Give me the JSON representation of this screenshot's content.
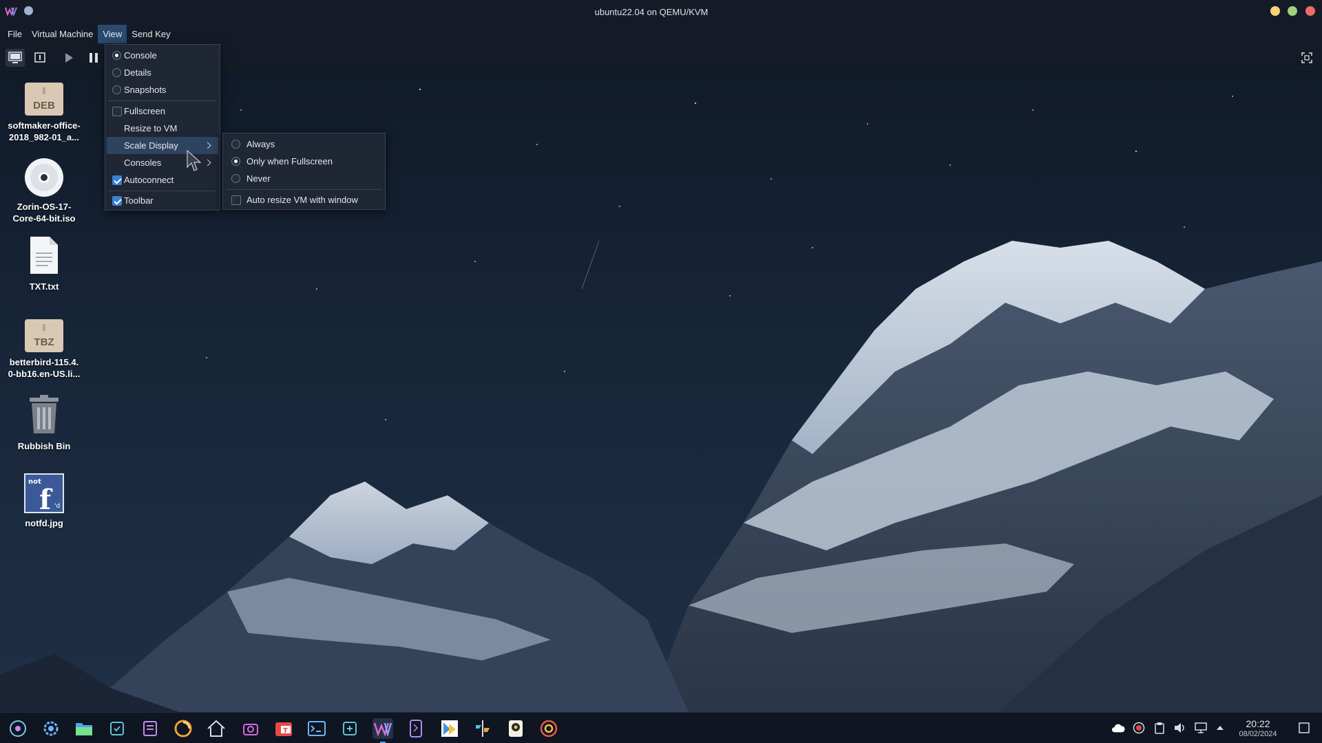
{
  "window": {
    "title": "ubuntu22.04 on QEMU/KVM"
  },
  "menubar": {
    "items": [
      "File",
      "Virtual Machine",
      "View",
      "Send Key"
    ],
    "active": "View"
  },
  "view_menu": {
    "items": [
      {
        "label": "Console",
        "type": "radio",
        "checked": true
      },
      {
        "label": "Details",
        "type": "radio",
        "checked": false
      },
      {
        "label": "Snapshots",
        "type": "radio",
        "checked": false
      },
      {
        "label": "Fullscreen",
        "type": "check",
        "checked": false
      },
      {
        "label": "Resize to VM",
        "type": "plain"
      },
      {
        "label": "Scale Display",
        "type": "submenu"
      },
      {
        "label": "Consoles",
        "type": "submenu"
      },
      {
        "label": "Autoconnect",
        "type": "check",
        "checked": true
      },
      {
        "label": "Toolbar",
        "type": "check",
        "checked": true
      }
    ]
  },
  "scale_menu": {
    "items": [
      {
        "label": "Always",
        "type": "radio",
        "checked": false
      },
      {
        "label": "Only when Fullscreen",
        "type": "radio",
        "checked": true
      },
      {
        "label": "Never",
        "type": "radio",
        "checked": false
      },
      {
        "label": "Auto resize VM with window",
        "type": "check",
        "checked": false
      }
    ]
  },
  "desktop": {
    "icons": [
      {
        "label1": "softmaker-office-",
        "label2": "2018_982-01_a...",
        "badge": "DEB"
      },
      {
        "label1": "Zorin-OS-17-",
        "label2": "Core-64-bit.iso"
      },
      {
        "label1": "TXT.txt",
        "label2": ""
      },
      {
        "label1": "betterbird-115.4.",
        "label2": "0-bb16.en-US.li...",
        "badge": "TBZ"
      },
      {
        "label1": "Rubbish Bin",
        "label2": ""
      },
      {
        "label1": "notfd.jpg",
        "label2": ""
      }
    ],
    "hidden_label_fragment": "notfd.jpg"
  },
  "taskbar": {
    "time": "20:22",
    "date": "08/02/2024"
  },
  "colors": {
    "accent": "#3d7fd4",
    "menu_bg": "#1f2634",
    "highlight": "#2e4360",
    "titlebar": "#151b26"
  }
}
